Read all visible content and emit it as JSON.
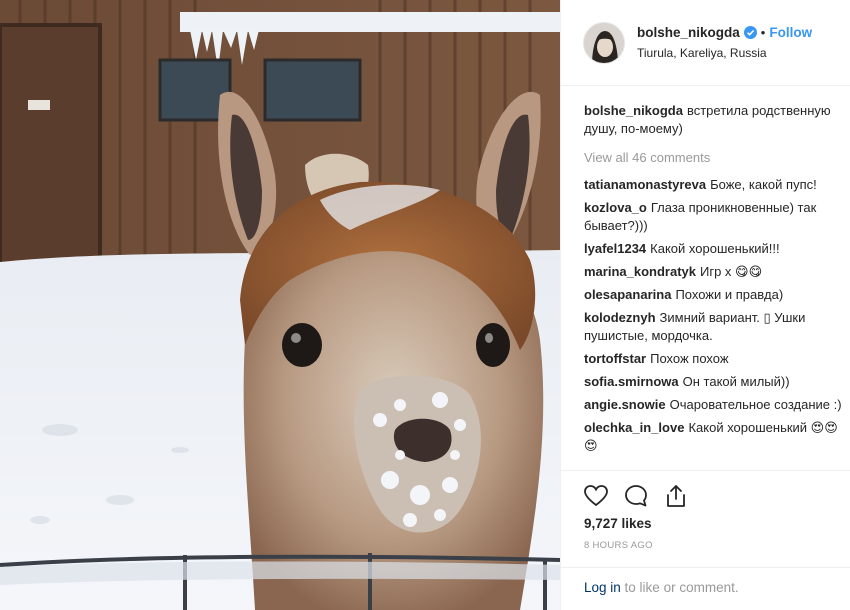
{
  "post": {
    "username": "bolshe_nikogda",
    "separator": "•",
    "follow_label": "Follow",
    "location": "Tiurula, Kareliya, Russia",
    "caption": "встретила родственную душу, по-моему)",
    "view_all_label": "View all 46 comments",
    "likes": "9,727 likes",
    "time": "8 HOURS AGO",
    "login_link": "Log in",
    "login_rest": " to like or comment."
  },
  "comments": [
    {
      "user": "tatianamonastyreva",
      "text": "Боже, какой пупс!"
    },
    {
      "user": "kozlova_o",
      "text": "Глаза проникновенные) так бывает?)))"
    },
    {
      "user": "lyafel1234",
      "text": "Какой хорошенький!!!"
    },
    {
      "user": "marina_kondratyk",
      "text": "Игр х 😋😋"
    },
    {
      "user": "olesapanarina",
      "text": "Похожи и правда)"
    },
    {
      "user": "kolodeznyh",
      "text": "Зимний вариант. ▯ Ушки пушистые, мордочка."
    },
    {
      "user": "tortoffstar",
      "text": "Похож похож"
    },
    {
      "user": "sofia.smirnowa",
      "text": "Он такой милый))"
    },
    {
      "user": "angie.snowie",
      "text": "Очаровательное создание :)"
    },
    {
      "user": "olechka_in_love",
      "text": "Какой хорошенький 😍😍 😍"
    }
  ],
  "icons": {
    "verified": "verified-badge-icon",
    "like": "heart-icon",
    "comment": "comment-bubble-icon",
    "share": "share-icon"
  },
  "colors": {
    "link_blue": "#3897f0",
    "muted": "#999999",
    "text": "#262626",
    "login_link": "#003569"
  }
}
